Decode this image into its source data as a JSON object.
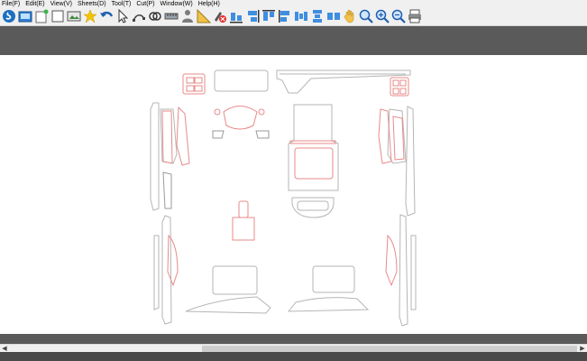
{
  "menu": {
    "items": [
      {
        "label": "File(F)"
      },
      {
        "label": "Edit(E)"
      },
      {
        "label": "View(V)"
      },
      {
        "label": "Sheets(D)"
      },
      {
        "label": "Tool(T)"
      },
      {
        "label": "Cut(P)"
      },
      {
        "label": "Window(W)"
      },
      {
        "label": "Help(H)"
      }
    ]
  },
  "toolbar": {
    "icons": [
      "app-logo-icon",
      "open-file-icon",
      "new-file-icon",
      "blank-page-icon",
      "image-icon",
      "favorite-star-icon",
      "undo-icon",
      "select-arrow-icon",
      "node-edit-icon",
      "weld-icon",
      "measure-icon",
      "person-icon",
      "triangle-ruler-icon",
      "cut-delete-icon",
      "align-bottom-icon",
      "align-right-icon",
      "align-top-icon",
      "align-left-icon",
      "distribute-horizontal-icon",
      "distribute-vertical-icon",
      "same-size-icon",
      "group-icon",
      "hand-pan-icon",
      "zoom-icon",
      "zoom-in-icon",
      "zoom-out-icon",
      "print-icon"
    ]
  },
  "colors": {
    "menubar_bg": "#f0f0f0",
    "dark_band": "#5a5a5a",
    "canvas_bg": "#ffffff",
    "outline_gray": "#b5b5b5",
    "outline_red": "#e88a8a"
  }
}
